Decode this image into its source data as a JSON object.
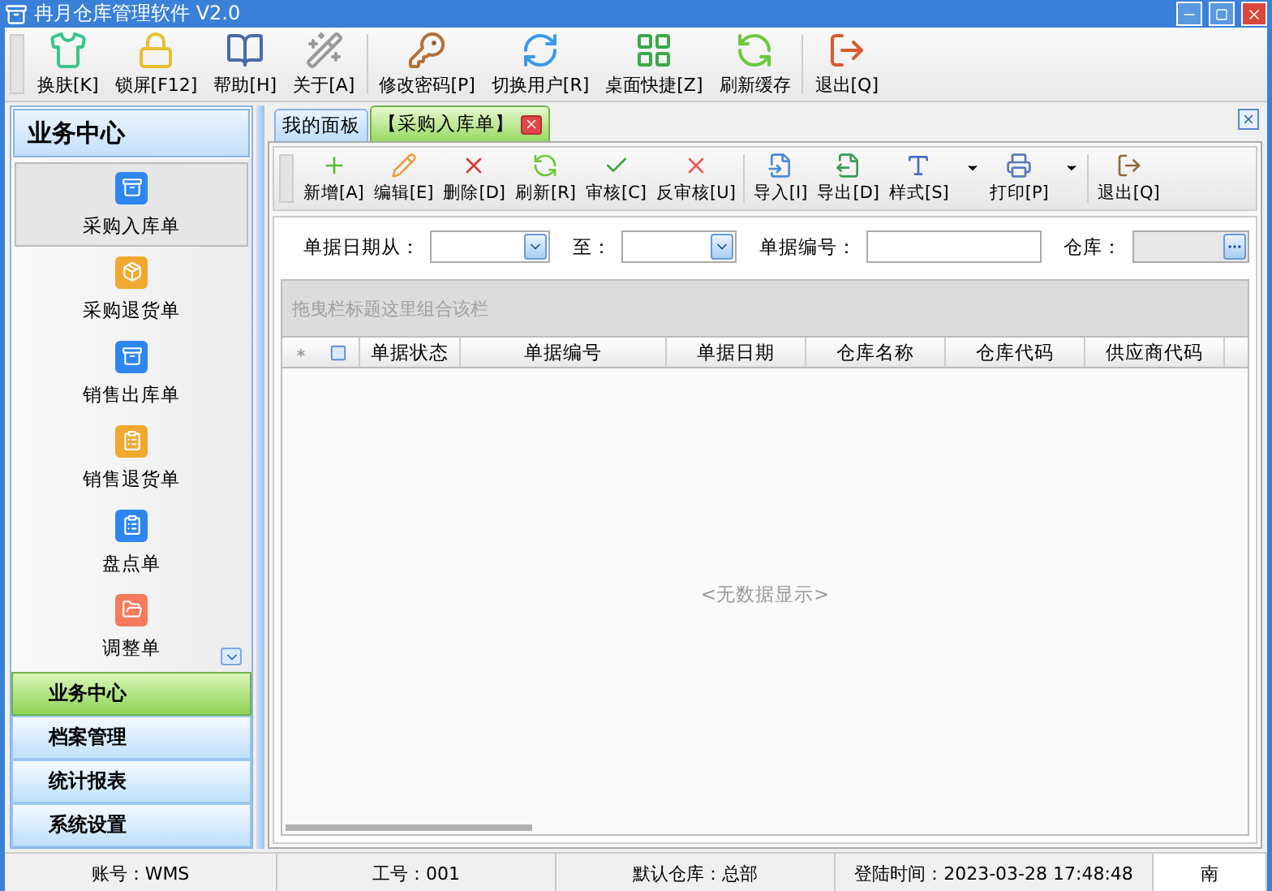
{
  "window": {
    "title": "冉月仓库管理软件 V2.0"
  },
  "main_toolbar": [
    [
      {
        "label": "换肤[K]"
      },
      {
        "label": "锁屏[F12]"
      },
      {
        "label": "帮助[H]"
      },
      {
        "label": "关于[A]"
      }
    ],
    [
      {
        "label": "修改密码[P]"
      },
      {
        "label": "切换用户[R]"
      },
      {
        "label": "桌面快捷[Z]"
      },
      {
        "label": "刷新缓存"
      }
    ],
    [
      {
        "label": "退出[Q]"
      }
    ]
  ],
  "sidebar": {
    "title": "业务中心",
    "items": [
      {
        "label": "采购入库单",
        "selected": true,
        "color": "#2f86f0"
      },
      {
        "label": "采购退货单",
        "selected": false,
        "color": "#f0a830"
      },
      {
        "label": "销售出库单",
        "selected": false,
        "color": "#2f86f0"
      },
      {
        "label": "销售退货单",
        "selected": false,
        "color": "#f0a830"
      },
      {
        "label": "盘点单",
        "selected": false,
        "color": "#2f86f0"
      },
      {
        "label": "调整单",
        "selected": false,
        "color": "#f57a5e"
      }
    ],
    "sections": [
      {
        "label": "业务中心",
        "selected": true
      },
      {
        "label": "档案管理",
        "selected": false
      },
      {
        "label": "统计报表",
        "selected": false
      },
      {
        "label": "系统设置",
        "selected": false
      }
    ]
  },
  "tabs": [
    {
      "label": "我的面板",
      "selected": false,
      "closable": false
    },
    {
      "label": "【采购入库单】",
      "selected": true,
      "closable": true
    }
  ],
  "doc_toolbar": [
    [
      {
        "label": "新增[A]",
        "has_menu": false
      },
      {
        "label": "编辑[E]",
        "has_menu": false
      },
      {
        "label": "删除[D]",
        "has_menu": false
      },
      {
        "label": "刷新[R]",
        "has_menu": false
      },
      {
        "label": "审核[C]",
        "has_menu": false
      },
      {
        "label": "反审核[U]",
        "has_menu": false
      }
    ],
    [
      {
        "label": "导入[I]",
        "has_menu": false
      },
      {
        "label": "导出[D]",
        "has_menu": false
      },
      {
        "label": "样式[S]",
        "has_menu": true
      },
      {
        "label": "打印[P]",
        "has_menu": true
      }
    ],
    [
      {
        "label": "退出[Q]",
        "has_menu": false
      }
    ]
  ],
  "filters": [
    {
      "label": "单据日期从：",
      "kind": "date"
    },
    {
      "label": "至：",
      "kind": "date"
    },
    {
      "label": "单据编号：",
      "kind": "text"
    },
    {
      "label": "仓库：",
      "kind": "lookup"
    }
  ],
  "grid": {
    "group_panel_hint": "拖曳栏标题这里组合该栏",
    "select_all_checked": false,
    "columns": [
      "单据状态",
      "单据编号",
      "单据日期",
      "仓库名称",
      "仓库代码",
      "供应商代码"
    ],
    "empty_text": "<无数据显示>"
  },
  "status_bar": [
    "账号：WMS",
    "工号：001",
    "默认仓库：总部",
    "登陆时间：2023-03-28 17:48:48",
    "南"
  ]
}
